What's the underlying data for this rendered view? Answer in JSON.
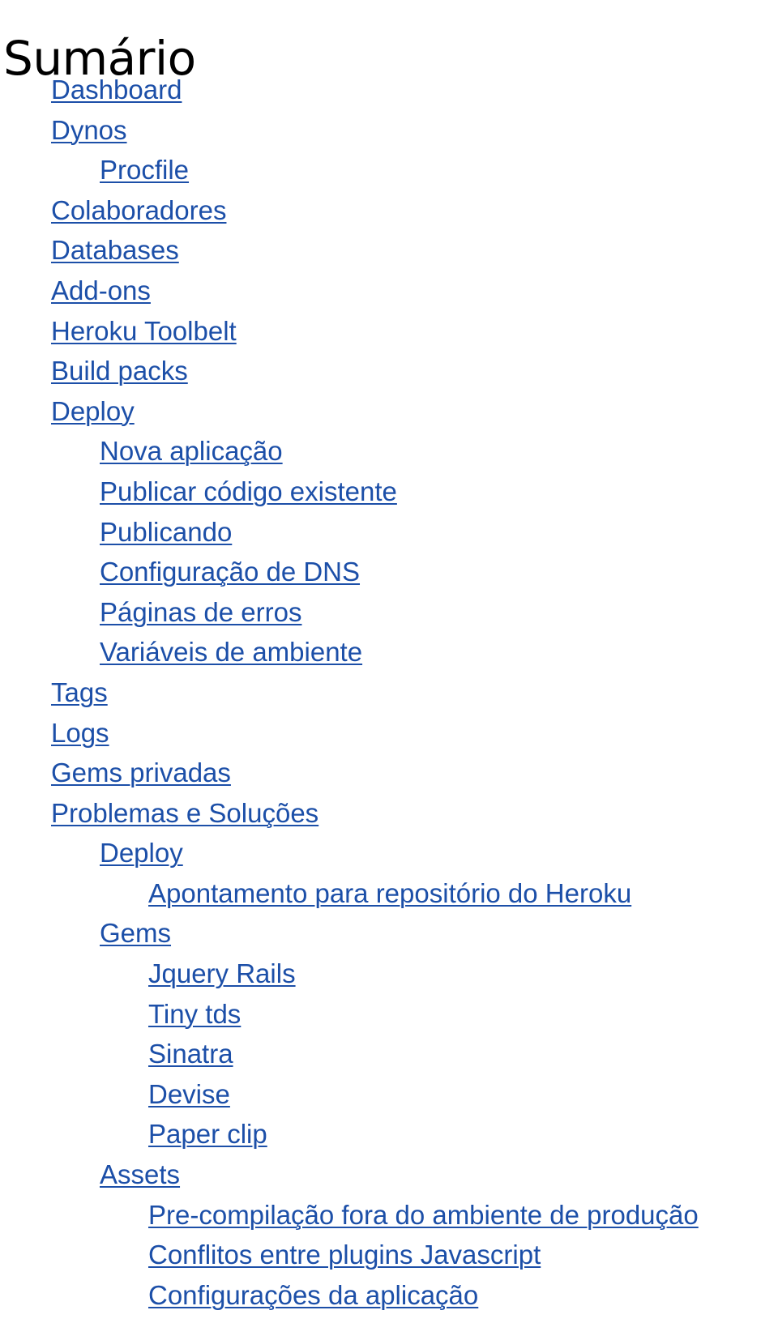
{
  "title": "Sumário",
  "link_color": "#1c4fa8",
  "items": [
    {
      "label": "Dashboard",
      "level": 0
    },
    {
      "label": "Dynos",
      "level": 0
    },
    {
      "label": "Procfile",
      "level": 1
    },
    {
      "label": "Colaboradores",
      "level": 0
    },
    {
      "label": "Databases",
      "level": 0
    },
    {
      "label": "Add-ons",
      "level": 0
    },
    {
      "label": "Heroku Toolbelt",
      "level": 0
    },
    {
      "label": "Build packs",
      "level": 0
    },
    {
      "label": "Deploy",
      "level": 0
    },
    {
      "label": "Nova aplicação",
      "level": 1
    },
    {
      "label": "Publicar código existente",
      "level": 1
    },
    {
      "label": "Publicando",
      "level": 1
    },
    {
      "label": "Configuração de DNS",
      "level": 1
    },
    {
      "label": "Páginas de erros",
      "level": 1
    },
    {
      "label": "Variáveis de ambiente",
      "level": 1
    },
    {
      "label": "Tags",
      "level": 0
    },
    {
      "label": "Logs",
      "level": 0
    },
    {
      "label": "Gems privadas",
      "level": 0
    },
    {
      "label": "Problemas e Soluções",
      "level": 0
    },
    {
      "label": "Deploy",
      "level": 1
    },
    {
      "label": "Apontamento para repositório do Heroku",
      "level": 2
    },
    {
      "label": "Gems",
      "level": 1
    },
    {
      "label": "Jquery Rails",
      "level": 2
    },
    {
      "label": "Tiny tds",
      "level": 2
    },
    {
      "label": "Sinatra",
      "level": 2
    },
    {
      "label": "Devise",
      "level": 2
    },
    {
      "label": "Paper clip",
      "level": 2
    },
    {
      "label": "Assets",
      "level": 1
    },
    {
      "label": "Pre-compilação fora do ambiente de produção",
      "level": 2
    },
    {
      "label": "Conflitos entre plugins Javascript",
      "level": 2
    },
    {
      "label": "Configurações da aplicação",
      "level": 2
    }
  ]
}
